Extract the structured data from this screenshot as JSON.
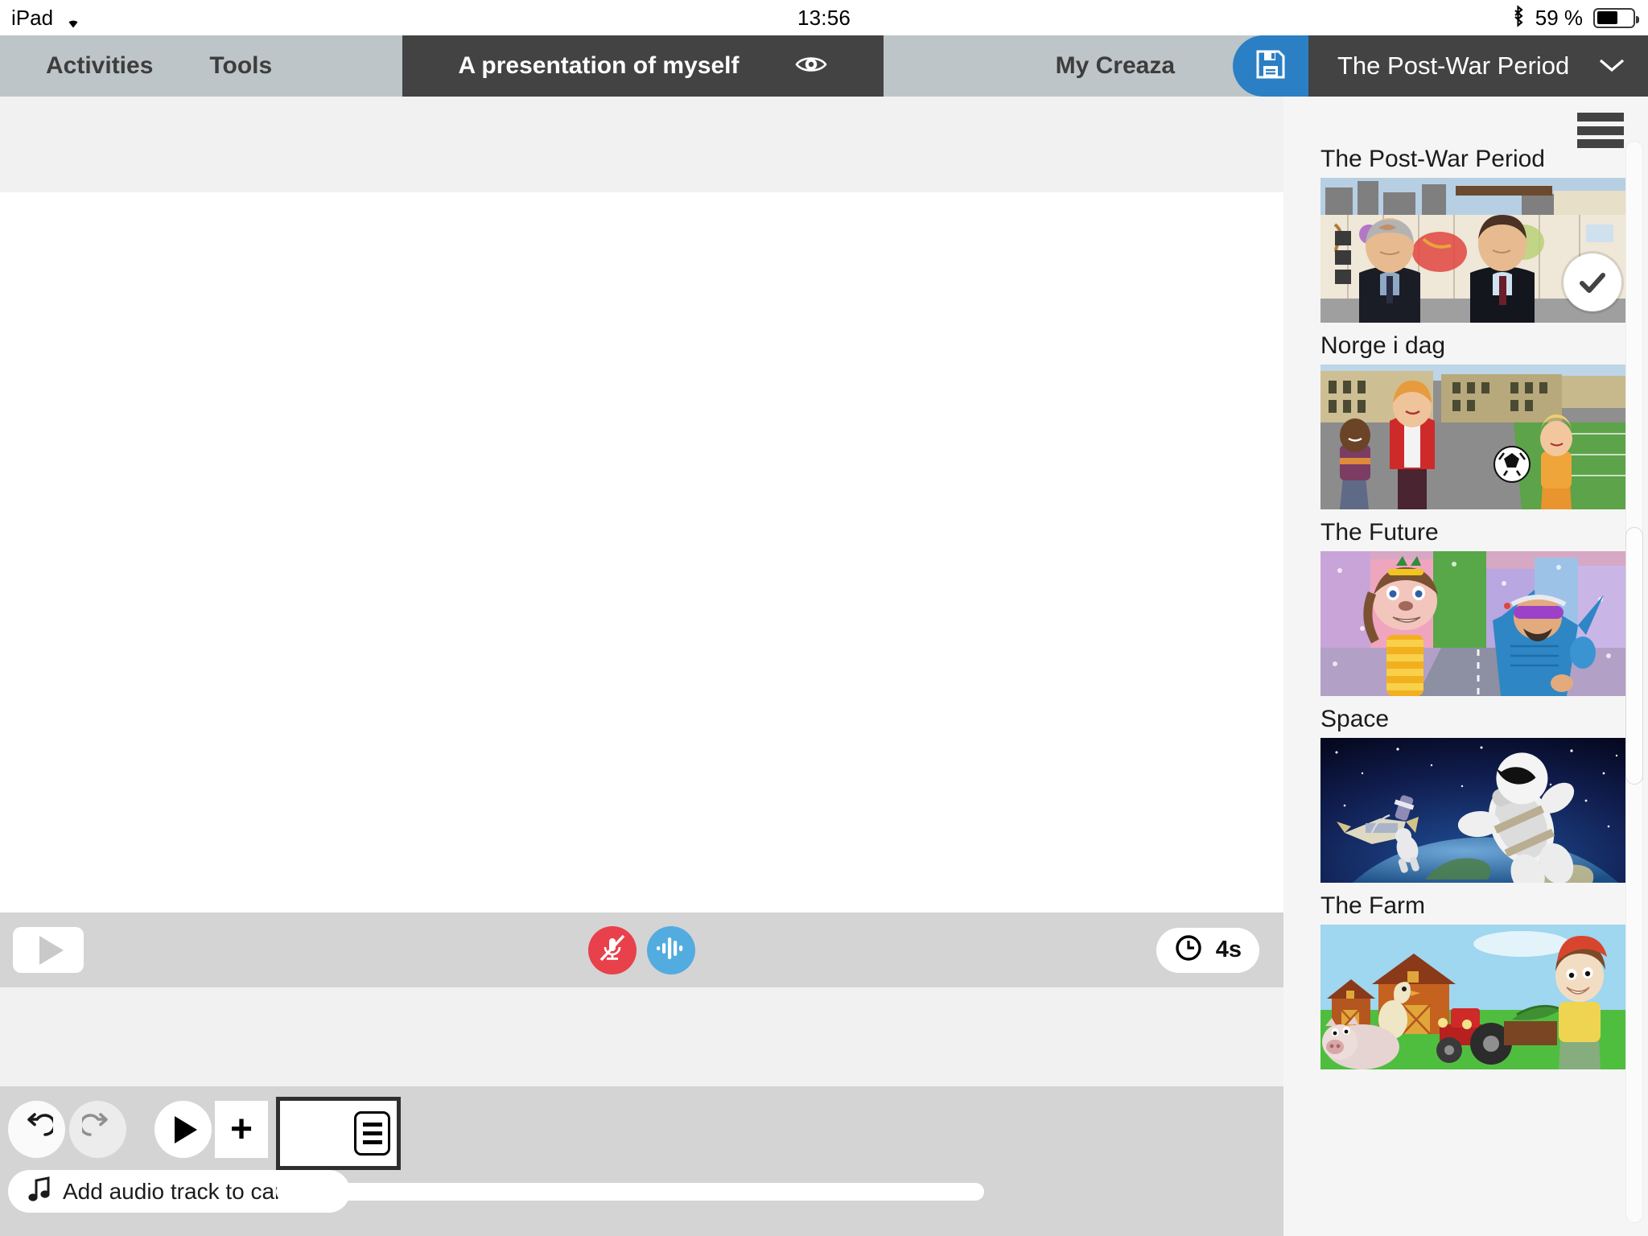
{
  "status_bar": {
    "device": "iPad",
    "wifi_icon": "wifi-icon",
    "time": "13:56",
    "bluetooth_icon": "bluetooth-icon",
    "battery_percent": "59 %",
    "battery_level": 59
  },
  "topnav": {
    "activities_label": "Activities",
    "tools_label": "Tools",
    "document_title": "A presentation of myself",
    "preview_icon": "eye-icon",
    "my_creaza_label": "My Creaza",
    "save_icon": "floppy-disk-icon",
    "scene_picker_label": "The Post-War Period",
    "scene_picker_chevron": "chevron-down-icon",
    "accent_color": "#2b7fc4",
    "bar_color": "#bdc5c8",
    "dark_color": "#434343"
  },
  "audio_bar": {
    "play_icon": "play-icon",
    "mic_off_icon": "microphone-off-icon",
    "waveform_icon": "sound-waveform-icon",
    "clock_icon": "clock-icon",
    "duration": "4s",
    "mic_off_color": "#e8414c",
    "waveform_color": "#53acdf"
  },
  "scene_toolbar": {
    "undo_icon": "undo-icon",
    "redo_icon": "redo-icon",
    "play_icon": "play-icon",
    "add_scene_label": "+",
    "scene_card_menu_icon": "hamburger-menu-icon",
    "add_audio_icon": "music-note-icon",
    "add_audio_label": "Add audio track to cartoon"
  },
  "scene_picker": {
    "menu_icon": "hamburger-menu-icon",
    "items": [
      {
        "label": "The Post-War Period",
        "selected": true,
        "check_icon": "check-icon"
      },
      {
        "label": "Norge i dag",
        "selected": false,
        "check_icon": "check-icon"
      },
      {
        "label": "The Future",
        "selected": false,
        "check_icon": "check-icon"
      },
      {
        "label": "Space",
        "selected": false,
        "check_icon": "check-icon"
      },
      {
        "label": "The Farm",
        "selected": false,
        "check_icon": "check-icon"
      }
    ]
  }
}
